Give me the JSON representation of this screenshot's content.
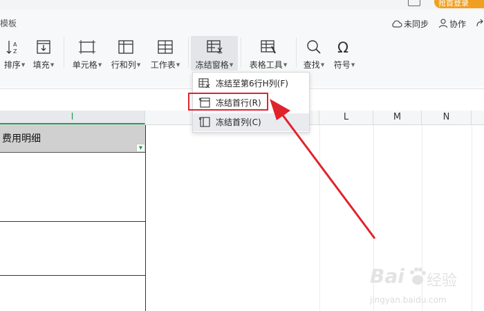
{
  "window": {
    "tab_template": "模板",
    "login_button": "抢首登录"
  },
  "toolbar_right": {
    "sync_label": "未同步",
    "collab_label": "协作"
  },
  "ribbon": {
    "items": [
      {
        "label": "排序",
        "icon": "sort-icon",
        "has_dropdown": true
      },
      {
        "label": "填充",
        "icon": "fill-icon",
        "has_dropdown": true
      },
      {
        "label": "单元格",
        "icon": "cell-icon",
        "has_dropdown": true
      },
      {
        "label": "行和列",
        "icon": "rows-columns-icon",
        "has_dropdown": true
      },
      {
        "label": "工作表",
        "icon": "worksheet-icon",
        "has_dropdown": true
      },
      {
        "label": "冻结窗格",
        "icon": "freeze-panes-icon",
        "has_dropdown": true,
        "active": true
      },
      {
        "label": "表格工具",
        "icon": "table-tools-icon",
        "has_dropdown": true
      },
      {
        "label": "查找",
        "icon": "search-icon",
        "has_dropdown": true
      },
      {
        "label": "符号",
        "icon": "omega-icon",
        "has_dropdown": true
      }
    ]
  },
  "freeze_menu": {
    "items": [
      {
        "label": "冻结至第6行H列(F)",
        "icon": "freeze-to-cell-icon"
      },
      {
        "label": "冻结首行(R)",
        "icon": "freeze-first-row-icon",
        "highlighted": true
      },
      {
        "label": "冻结首列(C)",
        "icon": "freeze-first-column-icon",
        "hover": true
      }
    ]
  },
  "columns": [
    "I",
    "L",
    "M",
    "N"
  ],
  "sheet": {
    "header_cell": "费用明细"
  },
  "watermark": {
    "brand": "Bai",
    "text": "经验",
    "url": "jingyan.baidu.com"
  },
  "colors": {
    "accent_green": "#20a050",
    "annotation_red": "#e0232b",
    "login_orange": "#f0a020"
  }
}
